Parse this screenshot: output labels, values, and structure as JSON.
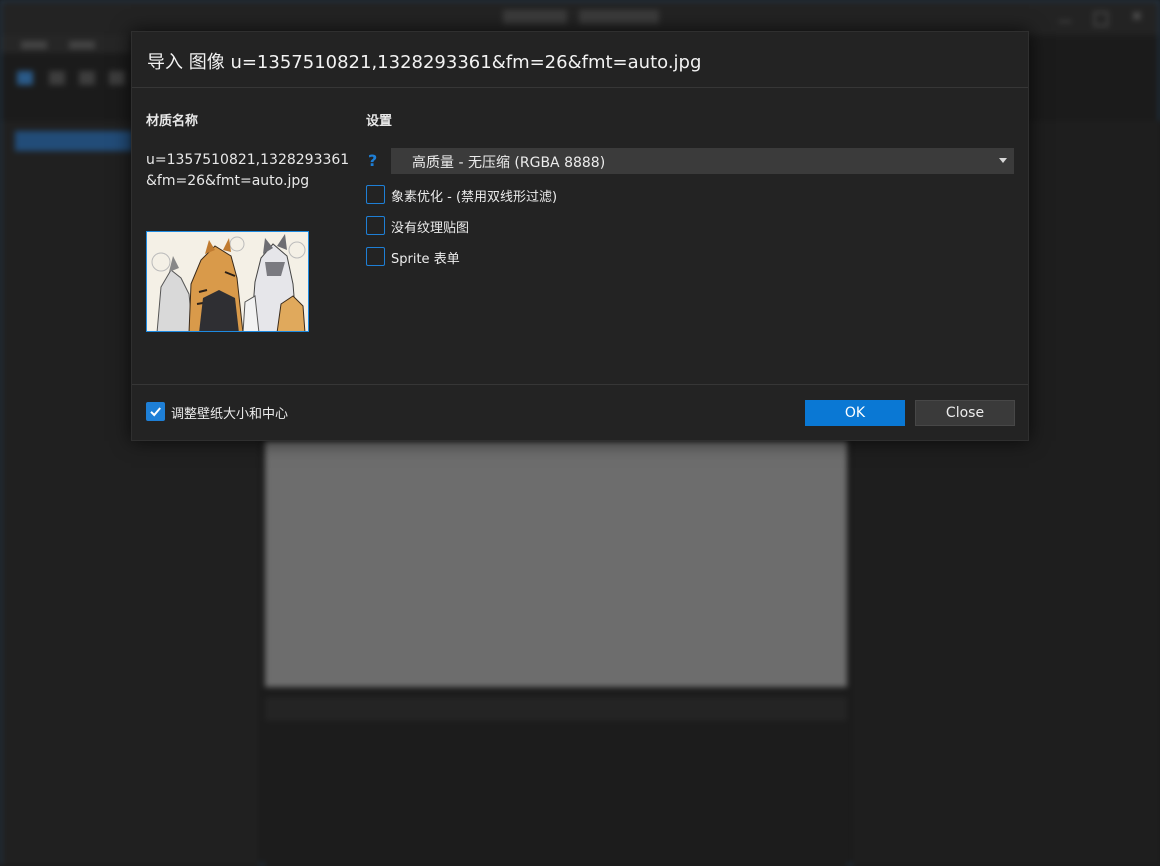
{
  "dialog": {
    "title": "导入 图像 u=1357510821,1328293361&fm=26&fmt=auto.jpg",
    "material_name_label": "材质名称",
    "material_name_value": "u=1357510821,1328293361&fm=26&fmt=auto.jpg",
    "settings_label": "设置",
    "help_icon_glyph": "?",
    "quality_select": {
      "selected": "高质量 - 无压缩 (RGBA 8888)"
    },
    "options": [
      {
        "label": "象素优化 - (禁用双线形过滤)",
        "checked": false
      },
      {
        "label": "没有纹理贴图",
        "checked": false
      },
      {
        "label": "Sprite 表单",
        "checked": false
      }
    ],
    "resize_checkbox": {
      "label": "调整壁纸大小和中心",
      "checked": true
    },
    "ok_label": "OK",
    "close_label": "Close"
  },
  "colors": {
    "accent": "#0a78d4",
    "dialog_bg": "#232323",
    "select_bg": "#3b3b3b"
  },
  "icons": {
    "help": "question-mark-icon",
    "dropdown": "chevron-down-icon",
    "check": "checkmark-icon"
  }
}
